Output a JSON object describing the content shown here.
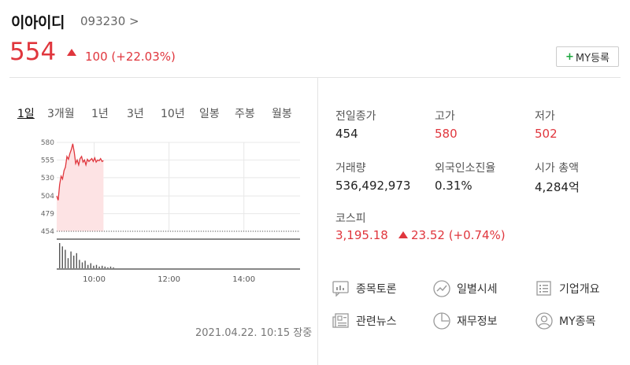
{
  "header": {
    "stock_name": "이아이디",
    "stock_code": "093230 >",
    "price": "554",
    "change": "100 (+22.03%)",
    "my_button_label": "MY등록"
  },
  "tabs": [
    "1일",
    "3개월",
    "1년",
    "3년",
    "10년",
    "일봉",
    "주봉",
    "월봉"
  ],
  "chart_data": {
    "type": "line",
    "series": [
      {
        "values": [
          504,
          498,
          520,
          532,
          528,
          540,
          545,
          560,
          556,
          564,
          570,
          578,
          566,
          550,
          555,
          548,
          557,
          560,
          552,
          555,
          548,
          556,
          553,
          555,
          557,
          553,
          558,
          552,
          555,
          554,
          557,
          553,
          554
        ]
      }
    ],
    "y_ticks": [
      "580",
      "555",
      "530",
      "504",
      "479",
      "454"
    ],
    "ylim": [
      454,
      580
    ],
    "x_ticks": [
      "10:00",
      "12:00",
      "14:00"
    ],
    "reference": 454,
    "volume_values": [
      30,
      26,
      22,
      12,
      20,
      15,
      18,
      10,
      7,
      9,
      4,
      6,
      3,
      4,
      2,
      3,
      2,
      1,
      2,
      1
    ]
  },
  "chart_footer": "2021.04.22. 10:15 장중",
  "stats": {
    "prev_close_label": "전일종가",
    "prev_close": "454",
    "high_label": "고가",
    "high": "580",
    "low_label": "저가",
    "low": "502",
    "volume_label": "거래량",
    "volume": "536,492,973",
    "foreign_label": "외국인소진율",
    "foreign": "0.31%",
    "mcap_label": "시가 총액",
    "mcap": "4,284억"
  },
  "index": {
    "label": "코스피",
    "value": "3,195.18",
    "change": "23.52 (+0.74%)"
  },
  "links": [
    "종목토론",
    "일별시세",
    "기업개요",
    "관련뉴스",
    "재무정보",
    "MY종목"
  ],
  "colors": {
    "up": "#e0363d",
    "plus": "#1aa63c",
    "fill": "#fde3e4"
  }
}
